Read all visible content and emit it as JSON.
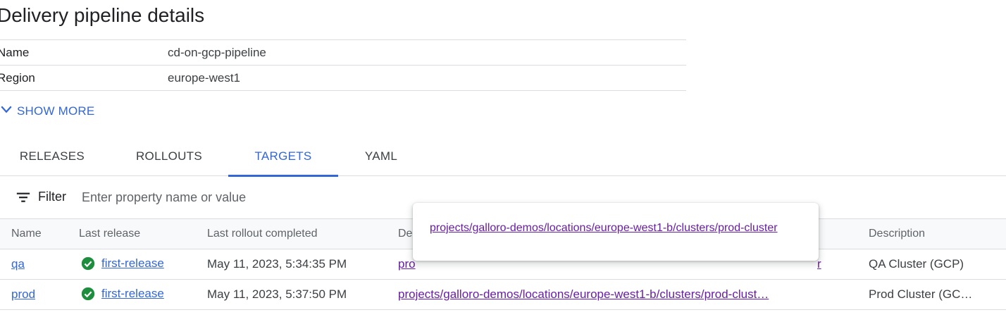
{
  "page": {
    "title": "Delivery pipeline details"
  },
  "details": [
    {
      "key": "Name",
      "value": "cd-on-gcp-pipeline"
    },
    {
      "key": "Region",
      "value": "europe-west1"
    }
  ],
  "show_more": {
    "label": "SHOW MORE"
  },
  "tabs": [
    {
      "label": "RELEASES",
      "active": false
    },
    {
      "label": "ROLLOUTS",
      "active": false
    },
    {
      "label": "TARGETS",
      "active": true
    },
    {
      "label": "YAML",
      "active": false
    }
  ],
  "filter": {
    "label": "Filter",
    "placeholder": "Enter property name or value"
  },
  "table": {
    "headers": {
      "name": "Name",
      "last_release": "Last release",
      "last_rollout": "Last rollout completed",
      "deployment_target": "De",
      "description": "Description"
    },
    "rows": [
      {
        "name": "qa",
        "last_release": "first-release",
        "last_rollout": "May 11, 2023, 5:34:35 PM",
        "deployment_target_visible": "pro",
        "deployment_target_tail": "r",
        "description": "QA Cluster (GCP)"
      },
      {
        "name": "prod",
        "last_release": "first-release",
        "last_rollout": "May 11, 2023, 5:37:50 PM",
        "deployment_target_visible": "projects/galloro-demos/locations/europe-west1-b/clusters/prod-clust…",
        "description": "Prod Cluster (GC…"
      }
    ]
  },
  "tooltip": {
    "text": "projects/galloro-demos/locations/europe-west1-b/clusters/prod-cluster"
  },
  "colors": {
    "accent": "#3367d6",
    "visited_link": "#681da8",
    "success": "#1e8e3e"
  },
  "icons": {
    "show_more": "chevron-down-icon",
    "filter": "filter-icon",
    "status": "check-circle-icon"
  }
}
